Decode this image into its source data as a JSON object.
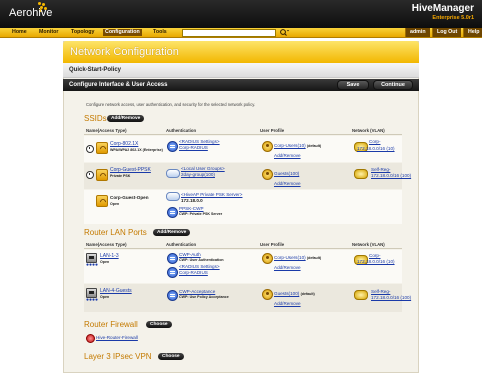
{
  "header": {
    "logo": "Aerohive",
    "product": "HiveManager",
    "edition": "Enterprise 5.0r1"
  },
  "menu": {
    "items": [
      "Home",
      "Monitor",
      "Topology",
      "Configuration",
      "Tools"
    ],
    "active": "Configuration",
    "search_value": "",
    "right": [
      "admin",
      "Log Out",
      "Help"
    ]
  },
  "panel": {
    "title": "Network Configuration",
    "policy": "Quick-Start-Policy",
    "section": "Configure Interface & User Access",
    "save": "Save",
    "continue": "Continue",
    "description": "Configure network access, user authentication, and security for the selected network policy."
  },
  "ssids": {
    "title": "SSIDs",
    "add_remove": "Add/Remove",
    "columns": [
      "Name(Access Type)",
      "Authentication",
      "User Profile",
      "Network (VLAN)"
    ],
    "rows": [
      {
        "name": "Corp-802.1X",
        "access": "WPA/WPA2 802.1X (Enterprise)",
        "auth_line1": "<RADIUS Settings>",
        "auth_line2": "Corp-RADIUS",
        "profile": "Corp-Users(10)",
        "profile_suffix": "(default)",
        "add_remove": "Add/Remove",
        "vlan_line1": "Corp-",
        "vlan_line2": "172.18.0.0/16 (10)"
      },
      {
        "name": "Corp-Guest-PPSK",
        "access": "Private PSK",
        "auth_line1": "<Local User Groups>",
        "auth_line2": "2day-group(100)",
        "profile": "Guests(100)",
        "profile_suffix": "",
        "add_remove": "Add/Remove",
        "vlan_line1": "Self-Reg-",
        "vlan_line2": "172.18.0.0/16 (100)"
      },
      {
        "name": "Corp-Guest-Open",
        "access": "Open",
        "auth_line1": "<HiveAP Private PSK Server>",
        "auth_line2": "172.18.0.0",
        "auth_line3": "PPSK-CWP",
        "auth_line4": "CWP: Private PSK Server"
      }
    ]
  },
  "router_lan": {
    "title": "Router LAN Ports",
    "add_remove": "Add/Remove",
    "columns": [
      "Name(Access Type)",
      "Authentication",
      "User Profile",
      "Network (VLAN)"
    ],
    "rows": [
      {
        "name": "LAN-1-3",
        "access": "Open",
        "auth_line1": "CWP-Auth",
        "auth_line2": "CWP: User Authentication",
        "auth_line3": "<RADIUS Settings>",
        "auth_line4": "Corp-RADIUS",
        "profile": "Corp-Users(10)",
        "profile_suffix": "(default)",
        "add_remove": "Add/Remove",
        "vlan_line1": "Corp-",
        "vlan_line2": "172.18.0.0/16 (10)"
      },
      {
        "name": "LAN-4-Guests",
        "access": "Open",
        "auth_line1": "CWP-Acceptance",
        "auth_line2": "CWP: Use Policy Acceptance",
        "profile": "Guests(100)",
        "profile_suffix": "(default)",
        "add_remove": "Add/Remove",
        "vlan_line1": "Self-Reg-",
        "vlan_line2": "172.18.0.0/16 (100)"
      }
    ]
  },
  "router_firewall": {
    "title": "Router Firewall",
    "choose": "Choose",
    "item": "Hive-Router-Firewall"
  },
  "ipsec": {
    "title": "Layer 3 IPsec VPN",
    "choose": "Choose"
  }
}
